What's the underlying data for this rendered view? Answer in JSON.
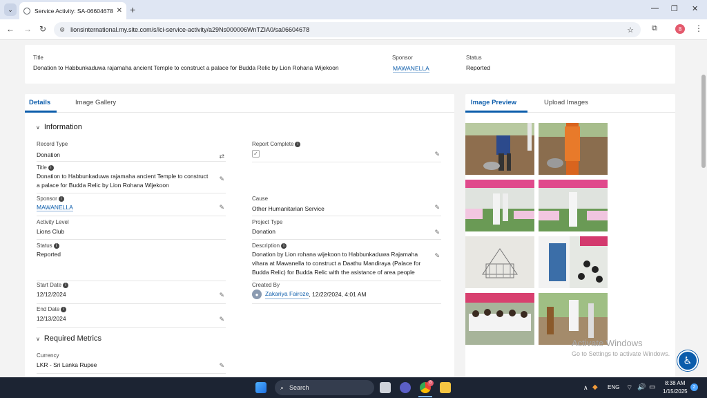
{
  "browser": {
    "tab_title": "Service Activity: SA-06604678",
    "url": "lionsinternational.my.site.com/s/lci-service-activity/a29Ns000006WnTZIA0/sa06604678",
    "profile_initial": "8"
  },
  "header": {
    "title_label": "Title",
    "title_value": "Donation to Habbunkaduwa rajamaha ancient Temple to construct a palace for Budda Relic by Lion Rohana Wijekoon",
    "sponsor_label": "Sponsor",
    "sponsor_value": "MAWANELLA",
    "status_label": "Status",
    "status_value": "Reported"
  },
  "tabs": {
    "details": "Details",
    "gallery": "Image Gallery"
  },
  "information": {
    "section_title": "Information",
    "record_type_label": "Record Type",
    "record_type_value": "Donation",
    "report_complete_label": "Report Complete",
    "report_complete_checked": true,
    "title_label": "Title",
    "title_value": "Donation to Habbunkaduwa rajamaha ancient Temple to construct a palace for Budda Relic by Lion Rohana Wijekoon",
    "sponsor_label": "Sponsor",
    "sponsor_value": "MAWANELLA",
    "cause_label": "Cause",
    "cause_value": "Other Humanitarian Service",
    "activity_level_label": "Activity Level",
    "activity_level_value": "Lions Club",
    "project_type_label": "Project Type",
    "project_type_value": "Donation",
    "status_label": "Status",
    "status_value": "Reported",
    "description_label": "Description",
    "description_value": "Donation by Lion rohana wijekoon to Habbunkaduwa Rajamaha vihara at Mawanella to construct a Daathu Mandiraya (Palace for Budda Relic) for Budda Relic with the asistance of area people",
    "start_date_label": "Start Date",
    "start_date_value": "12/12/2024",
    "created_by_label": "Created By",
    "created_by_name": "Zakariya Fairoze",
    "created_by_date": ", 12/22/2024, 4:01 AM",
    "end_date_label": "End Date",
    "end_date_value": "12/13/2024"
  },
  "metrics": {
    "section_title": "Required Metrics",
    "currency_label": "Currency",
    "currency_value": "LKR - Sri Lanka Rupee"
  },
  "images": {
    "preview_tab": "Image Preview",
    "upload_tab": "Upload Images"
  },
  "watermark": {
    "title": "Activate Windows",
    "subtitle": "Go to Settings to activate Windows."
  },
  "taskbar": {
    "search_placeholder": "Search",
    "language": "ENG",
    "time": "8:38 AM",
    "date": "1/15/2025",
    "notifications": "2",
    "chrome_badge": "8"
  }
}
